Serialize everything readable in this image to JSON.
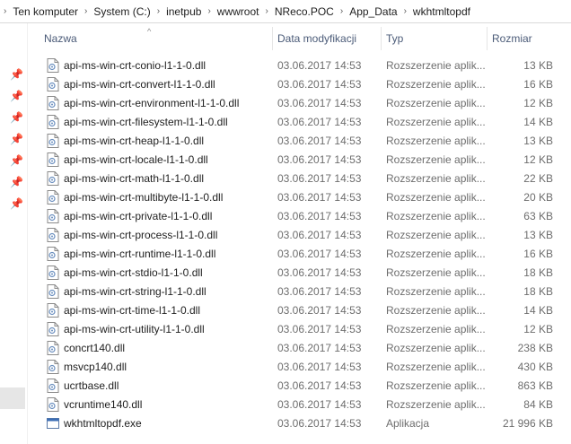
{
  "breadcrumb": [
    "Ten komputer",
    "System (C:)",
    "inetpub",
    "wwwroot",
    "NReco.POC",
    "App_Data",
    "wkhtmltopdf"
  ],
  "columns": {
    "name": "Nazwa",
    "date": "Data modyfikacji",
    "type": "Typ",
    "size": "Rozmiar"
  },
  "files": [
    {
      "name": "api-ms-win-crt-conio-l1-1-0.dll",
      "date": "03.06.2017 14:53",
      "type": "Rozszerzenie aplik...",
      "size": "13 KB",
      "icon": "dll-icon"
    },
    {
      "name": "api-ms-win-crt-convert-l1-1-0.dll",
      "date": "03.06.2017 14:53",
      "type": "Rozszerzenie aplik...",
      "size": "16 KB",
      "icon": "dll-icon"
    },
    {
      "name": "api-ms-win-crt-environment-l1-1-0.dll",
      "date": "03.06.2017 14:53",
      "type": "Rozszerzenie aplik...",
      "size": "12 KB",
      "icon": "dll-icon"
    },
    {
      "name": "api-ms-win-crt-filesystem-l1-1-0.dll",
      "date": "03.06.2017 14:53",
      "type": "Rozszerzenie aplik...",
      "size": "14 KB",
      "icon": "dll-icon"
    },
    {
      "name": "api-ms-win-crt-heap-l1-1-0.dll",
      "date": "03.06.2017 14:53",
      "type": "Rozszerzenie aplik...",
      "size": "13 KB",
      "icon": "dll-icon"
    },
    {
      "name": "api-ms-win-crt-locale-l1-1-0.dll",
      "date": "03.06.2017 14:53",
      "type": "Rozszerzenie aplik...",
      "size": "12 KB",
      "icon": "dll-icon"
    },
    {
      "name": "api-ms-win-crt-math-l1-1-0.dll",
      "date": "03.06.2017 14:53",
      "type": "Rozszerzenie aplik...",
      "size": "22 KB",
      "icon": "dll-icon"
    },
    {
      "name": "api-ms-win-crt-multibyte-l1-1-0.dll",
      "date": "03.06.2017 14:53",
      "type": "Rozszerzenie aplik...",
      "size": "20 KB",
      "icon": "dll-icon"
    },
    {
      "name": "api-ms-win-crt-private-l1-1-0.dll",
      "date": "03.06.2017 14:53",
      "type": "Rozszerzenie aplik...",
      "size": "63 KB",
      "icon": "dll-icon"
    },
    {
      "name": "api-ms-win-crt-process-l1-1-0.dll",
      "date": "03.06.2017 14:53",
      "type": "Rozszerzenie aplik...",
      "size": "13 KB",
      "icon": "dll-icon"
    },
    {
      "name": "api-ms-win-crt-runtime-l1-1-0.dll",
      "date": "03.06.2017 14:53",
      "type": "Rozszerzenie aplik...",
      "size": "16 KB",
      "icon": "dll-icon"
    },
    {
      "name": "api-ms-win-crt-stdio-l1-1-0.dll",
      "date": "03.06.2017 14:53",
      "type": "Rozszerzenie aplik...",
      "size": "18 KB",
      "icon": "dll-icon"
    },
    {
      "name": "api-ms-win-crt-string-l1-1-0.dll",
      "date": "03.06.2017 14:53",
      "type": "Rozszerzenie aplik...",
      "size": "18 KB",
      "icon": "dll-icon"
    },
    {
      "name": "api-ms-win-crt-time-l1-1-0.dll",
      "date": "03.06.2017 14:53",
      "type": "Rozszerzenie aplik...",
      "size": "14 KB",
      "icon": "dll-icon"
    },
    {
      "name": "api-ms-win-crt-utility-l1-1-0.dll",
      "date": "03.06.2017 14:53",
      "type": "Rozszerzenie aplik...",
      "size": "12 KB",
      "icon": "dll-icon"
    },
    {
      "name": "concrt140.dll",
      "date": "03.06.2017 14:53",
      "type": "Rozszerzenie aplik...",
      "size": "238 KB",
      "icon": "dll-icon"
    },
    {
      "name": "msvcp140.dll",
      "date": "03.06.2017 14:53",
      "type": "Rozszerzenie aplik...",
      "size": "430 KB",
      "icon": "dll-icon"
    },
    {
      "name": "ucrtbase.dll",
      "date": "03.06.2017 14:53",
      "type": "Rozszerzenie aplik...",
      "size": "863 KB",
      "icon": "dll-icon"
    },
    {
      "name": "vcruntime140.dll",
      "date": "03.06.2017 14:53",
      "type": "Rozszerzenie aplik...",
      "size": "84 KB",
      "icon": "dll-icon"
    },
    {
      "name": "wkhtmltopdf.exe",
      "date": "03.06.2017 14:53",
      "type": "Aplikacja",
      "size": "21 996 KB",
      "icon": "exe-icon"
    }
  ]
}
